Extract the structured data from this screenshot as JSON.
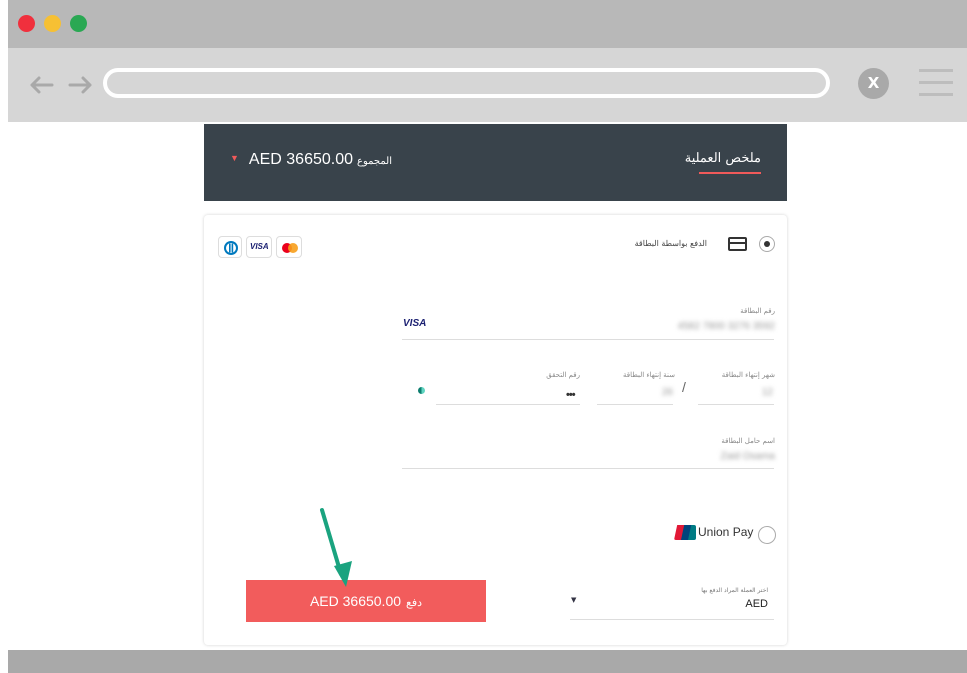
{
  "browser": {
    "window_controls": [
      "close-dot",
      "minimize-dot",
      "maximize-dot"
    ],
    "nav": {
      "back_icon": "arrow-left-icon",
      "forward_icon": "arrow-right-icon"
    },
    "url": "",
    "close_label": "X",
    "menu_icon": "hamburger-icon"
  },
  "summary": {
    "title": "ملخص العملية",
    "total_label": "المجموع",
    "total_amount": "AED 36650.00",
    "accent_color": "#f05a5a",
    "background_color": "#39434b"
  },
  "payment": {
    "card_option_label": "الدفع بواسطة البطاقة",
    "card_option_selected": true,
    "accepted_brands": [
      "diners-club",
      "visa",
      "mastercard"
    ],
    "visa_text": "VISA",
    "card_number_label": "رقم البطاقة",
    "card_number_value": "4582 7800 3276 3592",
    "card_brand_detected": "VISA",
    "expiry_month_label": "شهر إنتهاء البطاقة",
    "expiry_month_value": "12",
    "expiry_year_label": "سنة إنتهاء البطاقة",
    "expiry_year_value": "26",
    "expiry_separator": "/",
    "cvv_label": "رقم التحقق",
    "cvv_value": "•••",
    "holder_label": "اسم حامل البطاقة",
    "holder_value": "Zaid Osama",
    "unionpay_label": "Union Pay",
    "unionpay_selected": false,
    "currency_label": "اختر العملة المراد الدفع بها",
    "currency_value": "AED",
    "pay_amount": "AED 36650.00",
    "pay_word": "دفع",
    "pay_button_color": "#f25c5c"
  },
  "annotation": {
    "arrow_color": "#1aa37f"
  }
}
